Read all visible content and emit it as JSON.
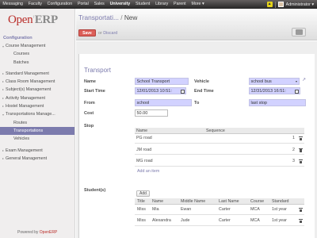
{
  "topbar": {
    "menu": [
      "Messaging",
      "Faculty",
      "Configuration",
      "Portal",
      "Sales",
      "University",
      "Student",
      "Library",
      "Parent",
      "More ▾"
    ],
    "active_index": 5,
    "user_name": "Administrator ▾",
    "notification_icon": "bell-icon"
  },
  "sidebar": {
    "logo_main": "Open",
    "logo_erp": "ERP",
    "section_title": "Configuration",
    "items": [
      {
        "label": "Course Management",
        "kind": "open"
      },
      {
        "label": "Courses",
        "kind": "sub"
      },
      {
        "label": "Batches",
        "kind": "sub"
      },
      {
        "label": "",
        "kind": "gap"
      },
      {
        "label": "Standard Management",
        "kind": "top"
      },
      {
        "label": "Class Room Management",
        "kind": "top"
      },
      {
        "label": "Subject(s) Management",
        "kind": "top"
      },
      {
        "label": "Activity Management",
        "kind": "top"
      },
      {
        "label": "Hostel Management",
        "kind": "top"
      },
      {
        "label": "Transportations Manage...",
        "kind": "open"
      },
      {
        "label": "Routes",
        "kind": "sub"
      },
      {
        "label": "Transportations",
        "kind": "sub-active"
      },
      {
        "label": "Vehicles",
        "kind": "sub"
      },
      {
        "label": "",
        "kind": "gap"
      },
      {
        "label": "Exam Management",
        "kind": "top"
      },
      {
        "label": "General Management",
        "kind": "top"
      }
    ],
    "powered_by": "Powered by",
    "powered_brand": "OpenERP"
  },
  "header": {
    "breadcrumb_link": "Transportati...",
    "breadcrumb_sep": " / ",
    "breadcrumb_current": "New",
    "save_label": "Save",
    "or_label": "or",
    "discard_label": "Discard"
  },
  "form": {
    "title": "Transport",
    "name_label": "Name",
    "name_value": "School Transport",
    "vehicle_label": "Vehicle",
    "vehicle_value": "school bus",
    "start_time_label": "Start Time",
    "start_time_value": "12/01/2013 10:51:",
    "end_time_label": "End Time",
    "end_time_value": "12/31/2013 16:51:",
    "from_label": "From",
    "from_value": "school",
    "to_label": "To",
    "to_value": "last stop",
    "cost_label": "Cost",
    "cost_value": "50.00",
    "stop_label": "Stop",
    "stops": {
      "headers": [
        "Name",
        "Sequence"
      ],
      "rows": [
        {
          "name": "PG road",
          "sequence": "1"
        },
        {
          "name": "JM road",
          "sequence": "2"
        },
        {
          "name": "MG road",
          "sequence": "3"
        }
      ],
      "add_item": "Add an item"
    },
    "students_label": "Student(s)",
    "students": {
      "add_label": "Add",
      "headers": [
        "Title",
        "Name",
        "Middle Name",
        "Last Name",
        "Course",
        "Standard"
      ],
      "rows": [
        {
          "title": "Miss",
          "name": "Mia",
          "middle": "Ewan",
          "last": "Carter",
          "course": "MCA",
          "standard": "1st year"
        },
        {
          "title": "Miss",
          "name": "Alexandra",
          "middle": "Jude",
          "last": "Carter",
          "course": "MCA",
          "standard": "1st year"
        }
      ]
    }
  }
}
